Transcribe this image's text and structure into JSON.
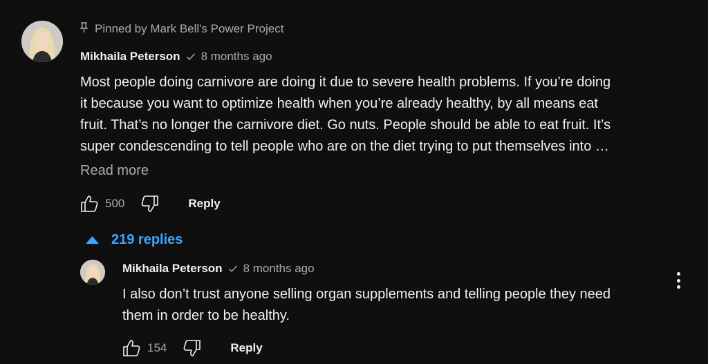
{
  "pinned": {
    "text": "Pinned by Mark Bell's Power Project",
    "icon": "pin-icon"
  },
  "comment": {
    "author": "Mikhaila Peterson",
    "time": "8 months ago",
    "text": "Most people doing carnivore are doing it due to severe health problems. If you’re doing\nit because you want to optimize health when you’re already healthy, by all means eat\nfruit. That’s no longer the carnivore diet. Go nuts. People should be able to eat fruit. It’s\nsuper condescending to tell people who are on the diet trying to put themselves into …",
    "read_more": "Read more",
    "likes": "500",
    "reply_label": "Reply"
  },
  "replies_toggle": {
    "label": "219 replies",
    "icon": "caret-up-icon"
  },
  "reply": {
    "author": "Mikhaila Peterson",
    "time": "8 months ago",
    "text": "I also don’t trust anyone selling organ supplements and telling people they need\nthem in order to be healthy.",
    "likes": "154",
    "reply_label": "Reply"
  },
  "colors": {
    "background": "#0f0f0f",
    "text": "#f1f1f1",
    "secondary": "#aaaaaa",
    "link": "#3ea6ff"
  }
}
